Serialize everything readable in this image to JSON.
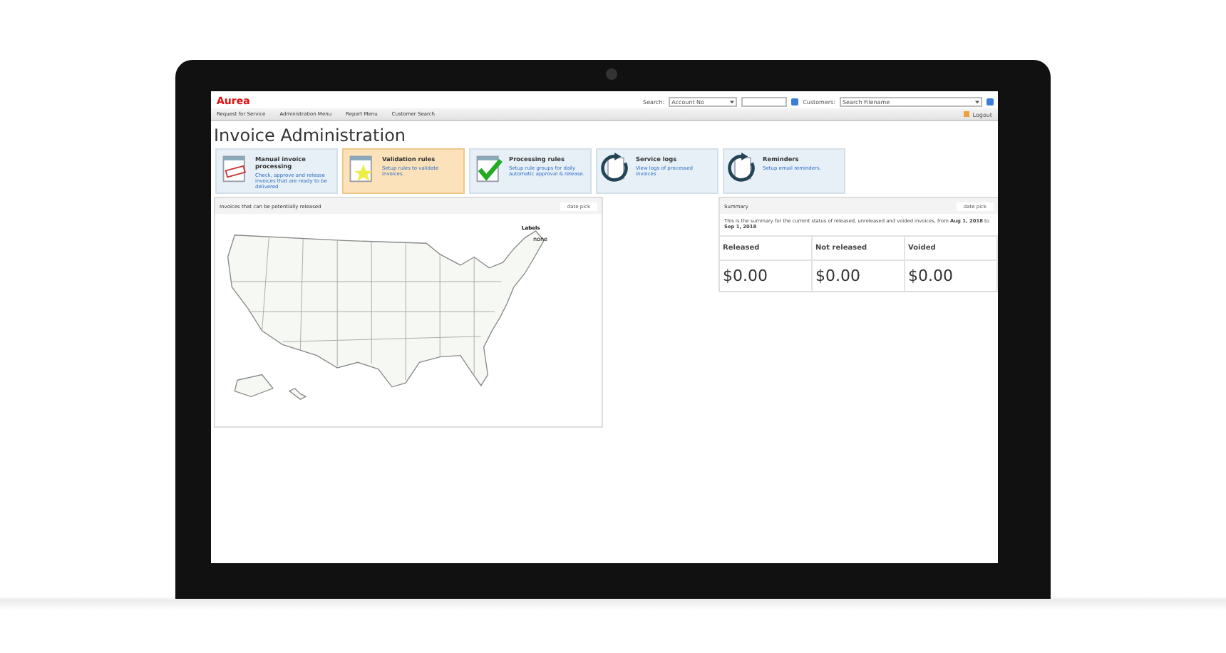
{
  "app": {
    "logo": "Aurea",
    "menu": [
      "Request for Service",
      "Administration Menu",
      "Report Menu",
      "Customer Search"
    ],
    "search_label": "Search:",
    "search_select": "Account No",
    "customers_label": "Customers:",
    "customers_select": "Search Filename",
    "logout": "Logout"
  },
  "page_title": "Invoice Administration",
  "tiles": [
    {
      "kind": "stamp",
      "title": "Manual invoice processing",
      "description": "Check, approve and release invoices that are ready to be delivered",
      "selected": false
    },
    {
      "kind": "star",
      "title": "Validation rules",
      "description": "Setup rules to validate invoices.",
      "selected": true
    },
    {
      "kind": "check",
      "title": "Processing rules",
      "description": "Setup rule groups for daily automatic approval & release.",
      "selected": false
    },
    {
      "kind": "cycle",
      "title": "Service logs",
      "description": "View logs of processed invoices",
      "selected": false
    },
    {
      "kind": "cycle",
      "title": "Reminders",
      "description": "Setup email reminders.",
      "selected": false
    }
  ],
  "map_panel": {
    "title": "Invoices that can be potentially released",
    "date_pick": "date pick",
    "legend_title": "Labels",
    "legend_value": "none"
  },
  "summary_panel": {
    "title": "Summary",
    "date_pick": "date pick",
    "text": "This is the summary for the current status of released, unreleased and voided invoices, from **Aug 1, 2018** to **Sep 1, 2018**",
    "columns": [
      {
        "label": "Released",
        "value": "$0.00"
      },
      {
        "label": "Not released",
        "value": "$0.00"
      },
      {
        "label": "Voided",
        "value": "$0.00"
      }
    ]
  }
}
